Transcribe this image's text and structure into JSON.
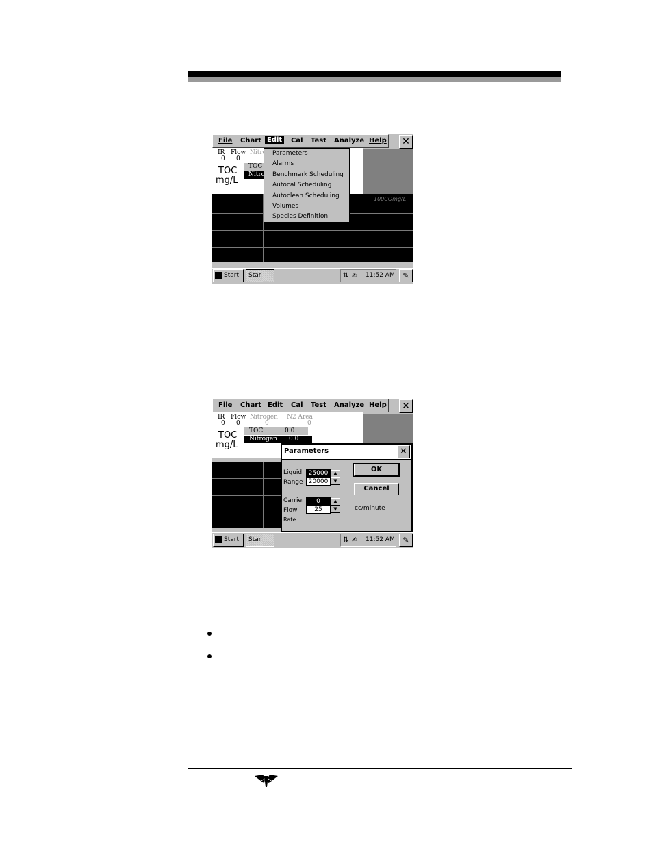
{
  "screen1": {
    "menu": [
      "File",
      "Chart",
      "Edit",
      "Cal",
      "Test",
      "Analyze",
      "Help"
    ],
    "close": "✕",
    "ir_label": "IR",
    "flow_label": "Flow",
    "nitro_partial": "Nitro",
    "ir_val": "0",
    "flow_val": "0",
    "toc": "TOC",
    "unit": "mg/L",
    "toc_row_partial": "TOC",
    "nitro_row_partial": "Nitro",
    "chart_label": "100COmg/L",
    "edit_menu": [
      "Parameters",
      "Alarms",
      "Benchmark Scheduling",
      "Autocal Scheduling",
      "Autoclean Scheduling",
      "Volumes",
      "Species Definition"
    ],
    "start": "Start",
    "task": "Star",
    "time": "11:52 AM"
  },
  "screen2": {
    "menu": [
      "File",
      "Chart",
      "Edit",
      "Cal",
      "Test",
      "Analyze",
      "Help"
    ],
    "close": "✕",
    "ir_label": "IR",
    "flow_label": "Flow",
    "nitrogen_label": "Nitrogen",
    "n2area_label": "N2 Area",
    "ir_val": "0",
    "flow_val": "0",
    "nitrogen_val": "0",
    "n2area_val": "0",
    "toc": "TOC",
    "unit": "mg/L",
    "toc_row_label": "TOC",
    "toc_row_val": "0.0",
    "nitrogen_row_label": "Nitrogen",
    "nitrogen_row_val": "0.0",
    "start": "Start",
    "task": "Star",
    "time": "11:52 AM",
    "dialog": {
      "title": "Parameters",
      "close": "✕",
      "liquid_label": "Liquid",
      "range_label": "Range",
      "liquid_val": "25000",
      "range_val": "20000",
      "carrier_label": "Carrier",
      "flow_label": "Flow",
      "rate_label": "Rate",
      "carrier_val": "0",
      "flow_val": "25",
      "unit": "cc/minute",
      "ok": "OK",
      "cancel": "Cancel"
    }
  }
}
